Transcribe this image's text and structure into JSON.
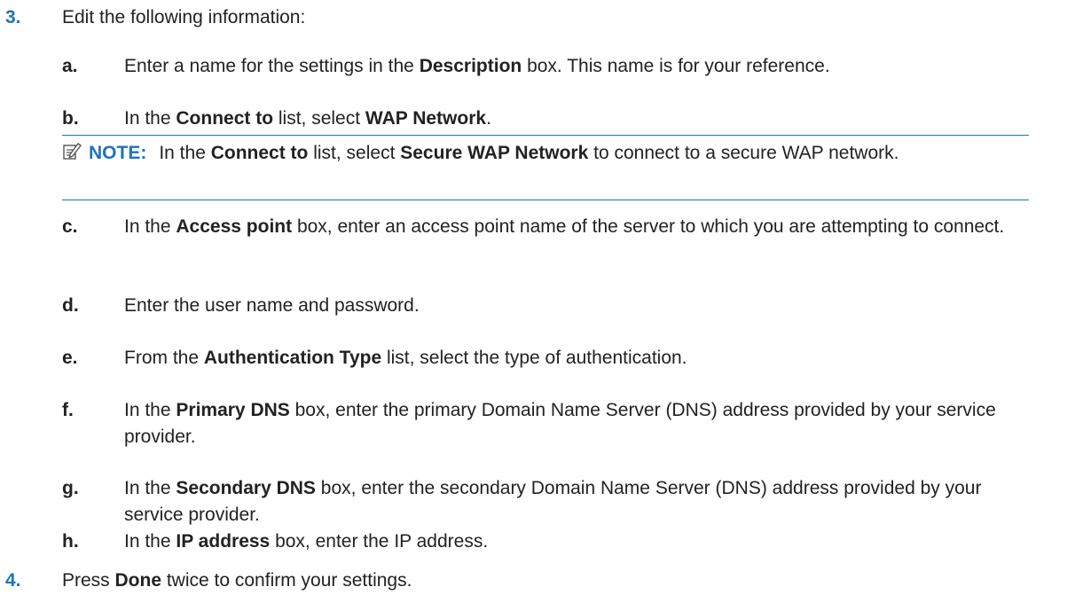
{
  "steps": {
    "step3": {
      "number": "3.",
      "text": "Edit the following information:",
      "a": {
        "letter": "a.",
        "p1": "Enter a name for the settings in the ",
        "b1": "Description",
        "p2": " box. This name is for your reference."
      },
      "b": {
        "letter": "b.",
        "p1": "In the ",
        "b1": "Connect to",
        "p2": " list, select ",
        "b2": "WAP Network",
        "p3": "."
      },
      "note": {
        "label": "NOTE:",
        "p1": "In the ",
        "b1": "Connect to",
        "p2": " list, select ",
        "b2": "Secure WAP Network",
        "p3": " to connect to a secure WAP network."
      },
      "c": {
        "letter": "c.",
        "p1": "In the ",
        "b1": "Access point",
        "p2": " box, enter an access point name of the server to which you are attempting to connect."
      },
      "d": {
        "letter": "d.",
        "p1": "Enter the user name and password."
      },
      "e": {
        "letter": "e.",
        "p1": "From the ",
        "b1": "Authentication Type",
        "p2": " list, select the type of authentication."
      },
      "f": {
        "letter": "f.",
        "p1": "In the ",
        "b1": "Primary DNS",
        "p2": " box, enter the primary Domain Name Server (DNS) address provided by your service provider."
      },
      "g": {
        "letter": "g.",
        "p1": "In the ",
        "b1": "Secondary DNS",
        "p2": " box, enter the secondary Domain Name Server (DNS) address provided by your service provider."
      },
      "h": {
        "letter": "h.",
        "p1": "In the ",
        "b1": "IP address",
        "p2": " box, enter the IP address."
      }
    },
    "step4": {
      "number": "4.",
      "p1": "Press ",
      "b1": "Done",
      "p2": " twice to confirm your settings."
    }
  },
  "colors": {
    "accent": "#1e73be",
    "text": "#222222"
  },
  "icons": {
    "note": "note-pencil-icon"
  }
}
